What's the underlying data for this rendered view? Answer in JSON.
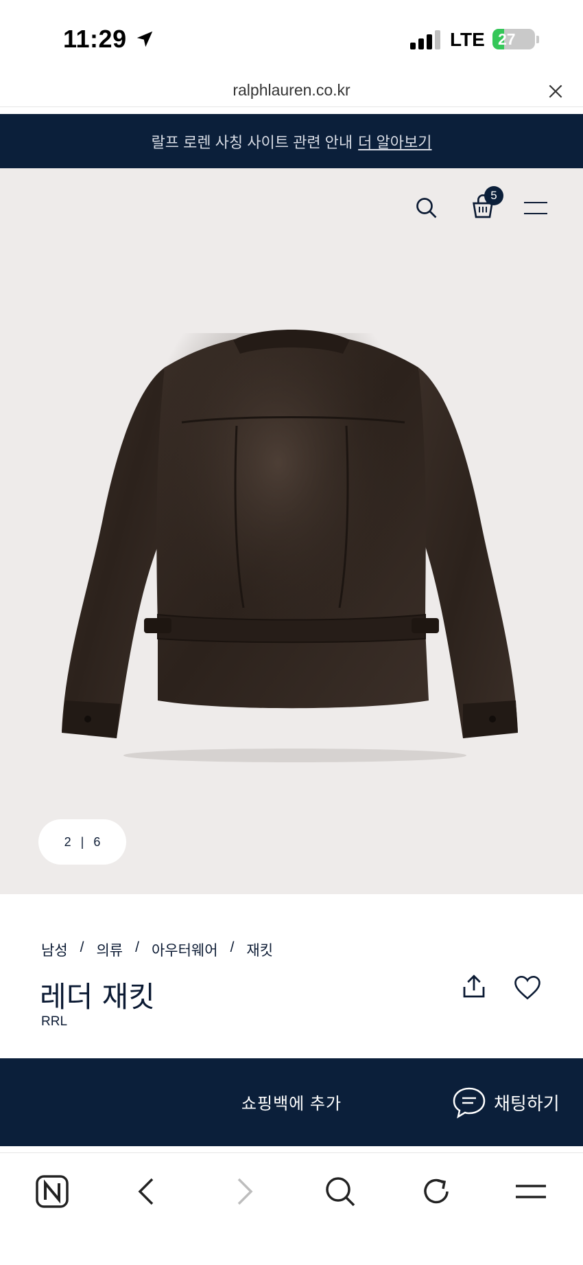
{
  "status_bar": {
    "time": "11:29",
    "network": "LTE",
    "battery": "27",
    "battery_level": 0.27
  },
  "browser": {
    "url": "ralphlauren.co.kr"
  },
  "banner": {
    "text": "랄프 로렌 사칭 사이트 관련 안내",
    "link": "더 알아보기"
  },
  "header": {
    "cart_count": "5"
  },
  "gallery": {
    "current": "2",
    "separator": "|",
    "total": "6"
  },
  "breadcrumb": [
    "남성",
    "의류",
    "아우터웨어",
    "재킷"
  ],
  "breadcrumb_sep": "/",
  "product": {
    "title": "레더 재킷",
    "brand": "RRL"
  },
  "actions": {
    "add_to_bag": "쇼핑백에 추가",
    "chat": "채팅하기"
  },
  "bottom_nav": [
    "n-home-icon",
    "back-icon",
    "forward-icon",
    "search-icon",
    "refresh-icon",
    "menu-icon"
  ],
  "colors": {
    "navy": "#0b1f3a",
    "image_bg": "#eeebea",
    "battery_green": "#35c759"
  }
}
